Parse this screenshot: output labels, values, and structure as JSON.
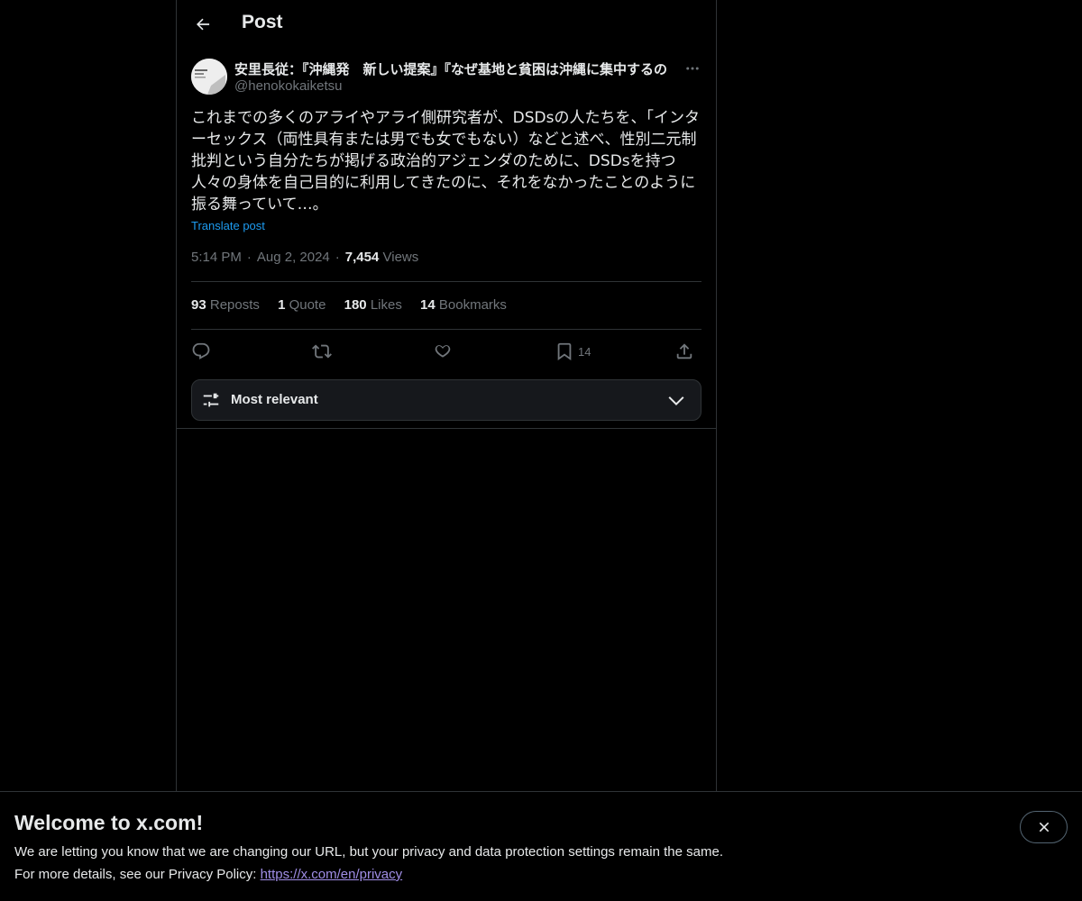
{
  "header": {
    "title": "Post",
    "back_icon": "arrow-left-icon"
  },
  "author": {
    "display_name": "安里長従：『沖縄発　新しい提案』『なぜ基地と貧困は沖縄に集中するの",
    "handle": "@henokokaiketsu"
  },
  "post": {
    "text": "これまでの多くのアライやアライ側研究者が、DSDsの人たちを、「インターセックス（両性具有または男でも女でもない）などと述べ、性別二元制批判という自分たちが掲げる政治的アジェンダのために、DSDsを持つ人々の身体を自己目的に利用してきたのに、それをなかったことのように振る舞っていて…。",
    "translate_label": "Translate post",
    "time": "5:14 PM",
    "date": "Aug 2, 2024",
    "views_count": "7,454",
    "views_label": "Views"
  },
  "stats": {
    "reposts_count": "93",
    "reposts_label": "Reposts",
    "quote_count": "1",
    "quote_label": "Quote",
    "likes_count": "180",
    "likes_label": "Likes",
    "bookmarks_count": "14",
    "bookmarks_label": "Bookmarks"
  },
  "actions": {
    "bookmark_count": "14"
  },
  "sort": {
    "label": "Most relevant"
  },
  "banner": {
    "title": "Welcome to x.com!",
    "line1": "We are letting you know that we are changing our URL, but your privacy and data protection settings remain the same.",
    "line2_prefix": "For more details, see our Privacy Policy: ",
    "link": "https://x.com/en/privacy"
  },
  "colors": {
    "background": "#000000",
    "text": "#e7e9ea",
    "muted": "#71767b",
    "link": "#1d9bf0",
    "border": "#2f3336"
  }
}
